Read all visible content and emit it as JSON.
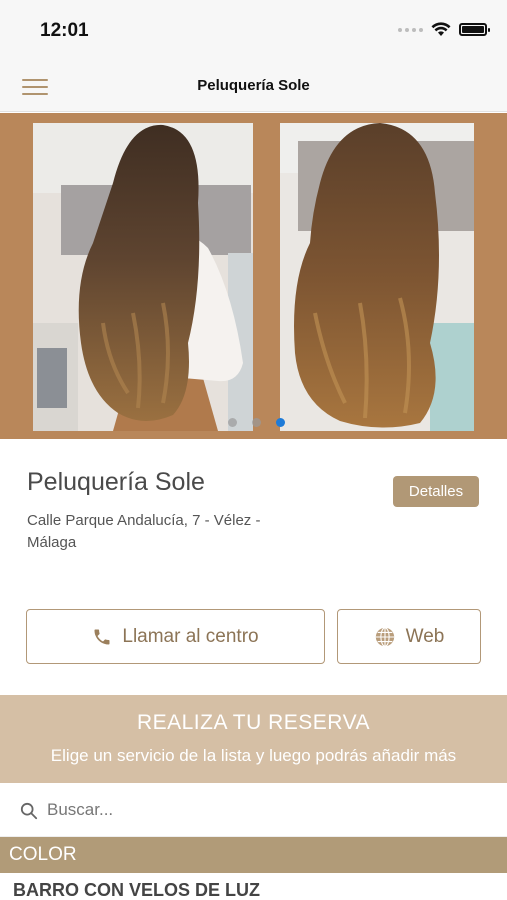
{
  "status_bar": {
    "time": "12:01"
  },
  "nav": {
    "title": "Peluquería Sole",
    "menu_icon": "hamburger-menu-icon"
  },
  "carousel": {
    "page_count": 3,
    "active_index": 2
  },
  "salon": {
    "name": "Peluquería Sole",
    "details_label": "Detalles",
    "address": "Calle Parque Andalucía, 7 - Vélez - Málaga"
  },
  "actions": {
    "call_label": "Llamar al centro",
    "call_icon": "phone-icon",
    "web_label": "Web",
    "web_icon": "globe-icon"
  },
  "booking": {
    "title": "REALIZA TU RESERVA",
    "subtitle": "Elige un servicio de la lista y luego podrás añadir más"
  },
  "search": {
    "placeholder": "Buscar...",
    "value": ""
  },
  "services": {
    "category": "COLOR",
    "first_item": "BARRO CON VELOS DE LUZ"
  },
  "colors": {
    "carousel_bg": "#b9875a",
    "accent": "#b19876",
    "banner": "#d5bfa5",
    "category_bar": "#b19b78",
    "active_dot": "#1e7bd8"
  }
}
